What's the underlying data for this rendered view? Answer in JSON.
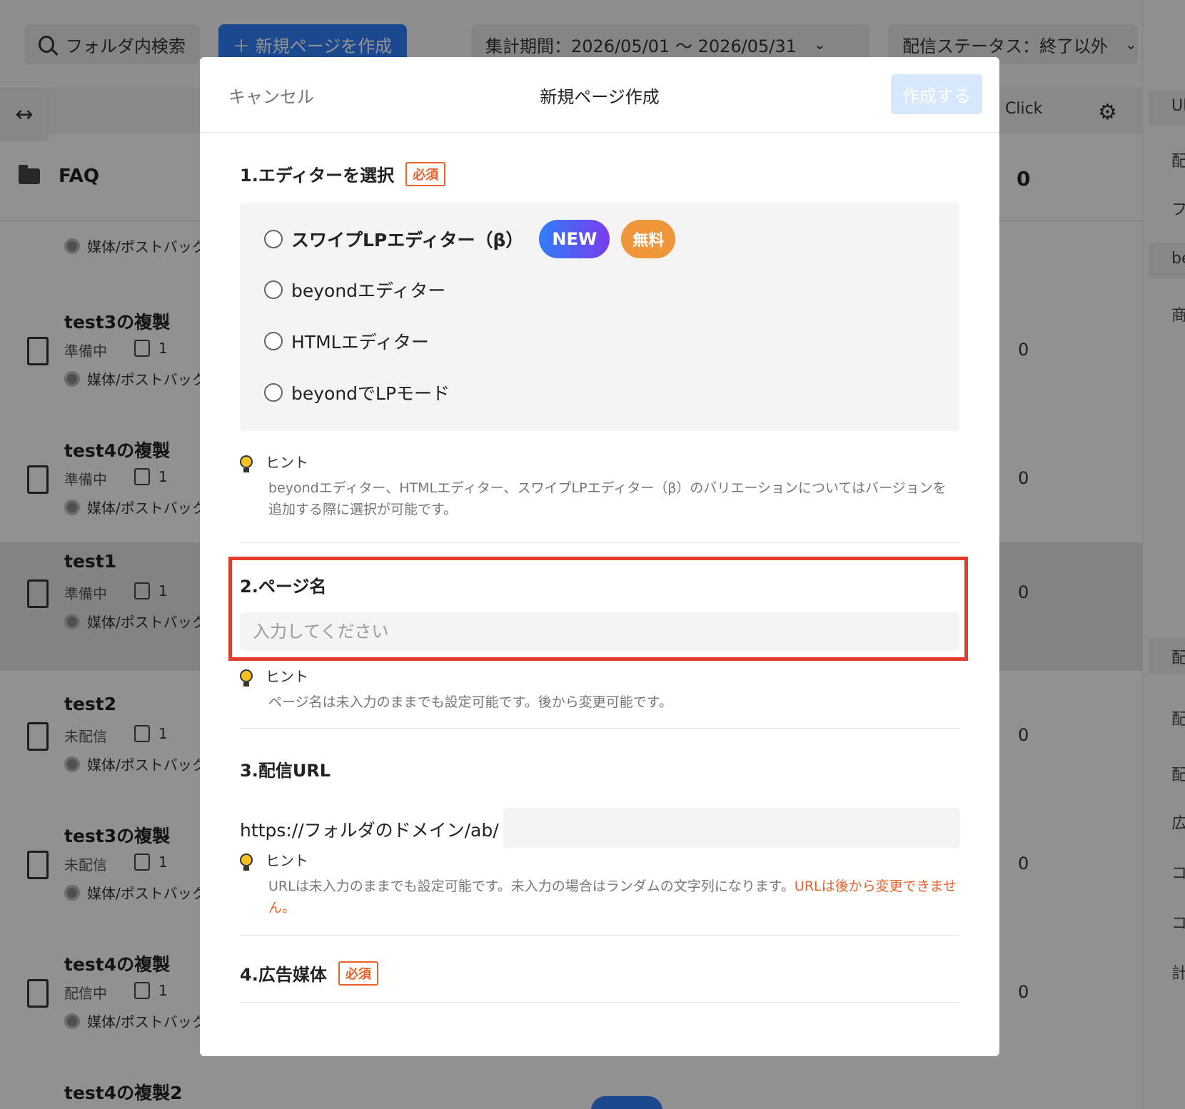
{
  "toolbar": {
    "folder_search": "フォルダ内検索",
    "new_page": "＋ 新規ページを作成",
    "period": "集計期間：2026/05/01 〜 2026/05/31",
    "status_filter": "配信ステータス：終了以外"
  },
  "table": {
    "click_header": "Click",
    "folder_name": "FAQ",
    "folder_count": "0",
    "media_label": "媒体/ポストバック",
    "rows": [
      {
        "title": "test3の複製",
        "status": "準備中",
        "count": "1",
        "clicks": "0"
      },
      {
        "title": "test4の複製",
        "status": "準備中",
        "count": "1",
        "clicks": "0"
      },
      {
        "title": "test1",
        "status": "準備中",
        "count": "1",
        "clicks": "0"
      },
      {
        "title": "test2",
        "status": "未配信",
        "count": "1",
        "clicks": "0"
      },
      {
        "title": "test3の複製",
        "status": "未配信",
        "count": "1",
        "clicks": "0"
      },
      {
        "title": "test4の複製",
        "status": "配信中",
        "count": "1",
        "clicks": "0"
      },
      {
        "title": "test4の複製2",
        "status": "",
        "count": "",
        "clicks": ""
      }
    ]
  },
  "right_sidebar": [
    "UI",
    "配",
    "フ",
    "be",
    "商",
    "配",
    "配",
    "配",
    "広",
    "コ",
    "コ",
    "計"
  ],
  "modal": {
    "cancel": "キャンセル",
    "title": "新規ページ作成",
    "create": "作成する",
    "required": "必須",
    "hint_label": "ヒント",
    "section1": {
      "title": "1.エディターを選択",
      "options": [
        "スワイプLPエディター（β）",
        "beyondエディター",
        "HTMLエディター",
        "beyondでLPモード"
      ],
      "badge_new": "NEW",
      "badge_free": "無料",
      "hint": "beyondエディター、HTMLエディター、スワイプLPエディター（β）のバリエーションについてはバージョンを追加する際に選択が可能です。"
    },
    "section2": {
      "title": "2.ページ名",
      "placeholder": "入力してください",
      "hint": "ページ名は未入力のままでも設定可能です。後から変更可能です。"
    },
    "section3": {
      "title": "3.配信URL",
      "prefix": "https://フォルダのドメイン/ab/",
      "hint": "URLは未入力のままでも設定可能です。未入力の場合はランダムの文字列になります。",
      "hint_warn": "URLは後から変更できません。"
    },
    "section4": {
      "title": "4.広告媒体"
    }
  }
}
